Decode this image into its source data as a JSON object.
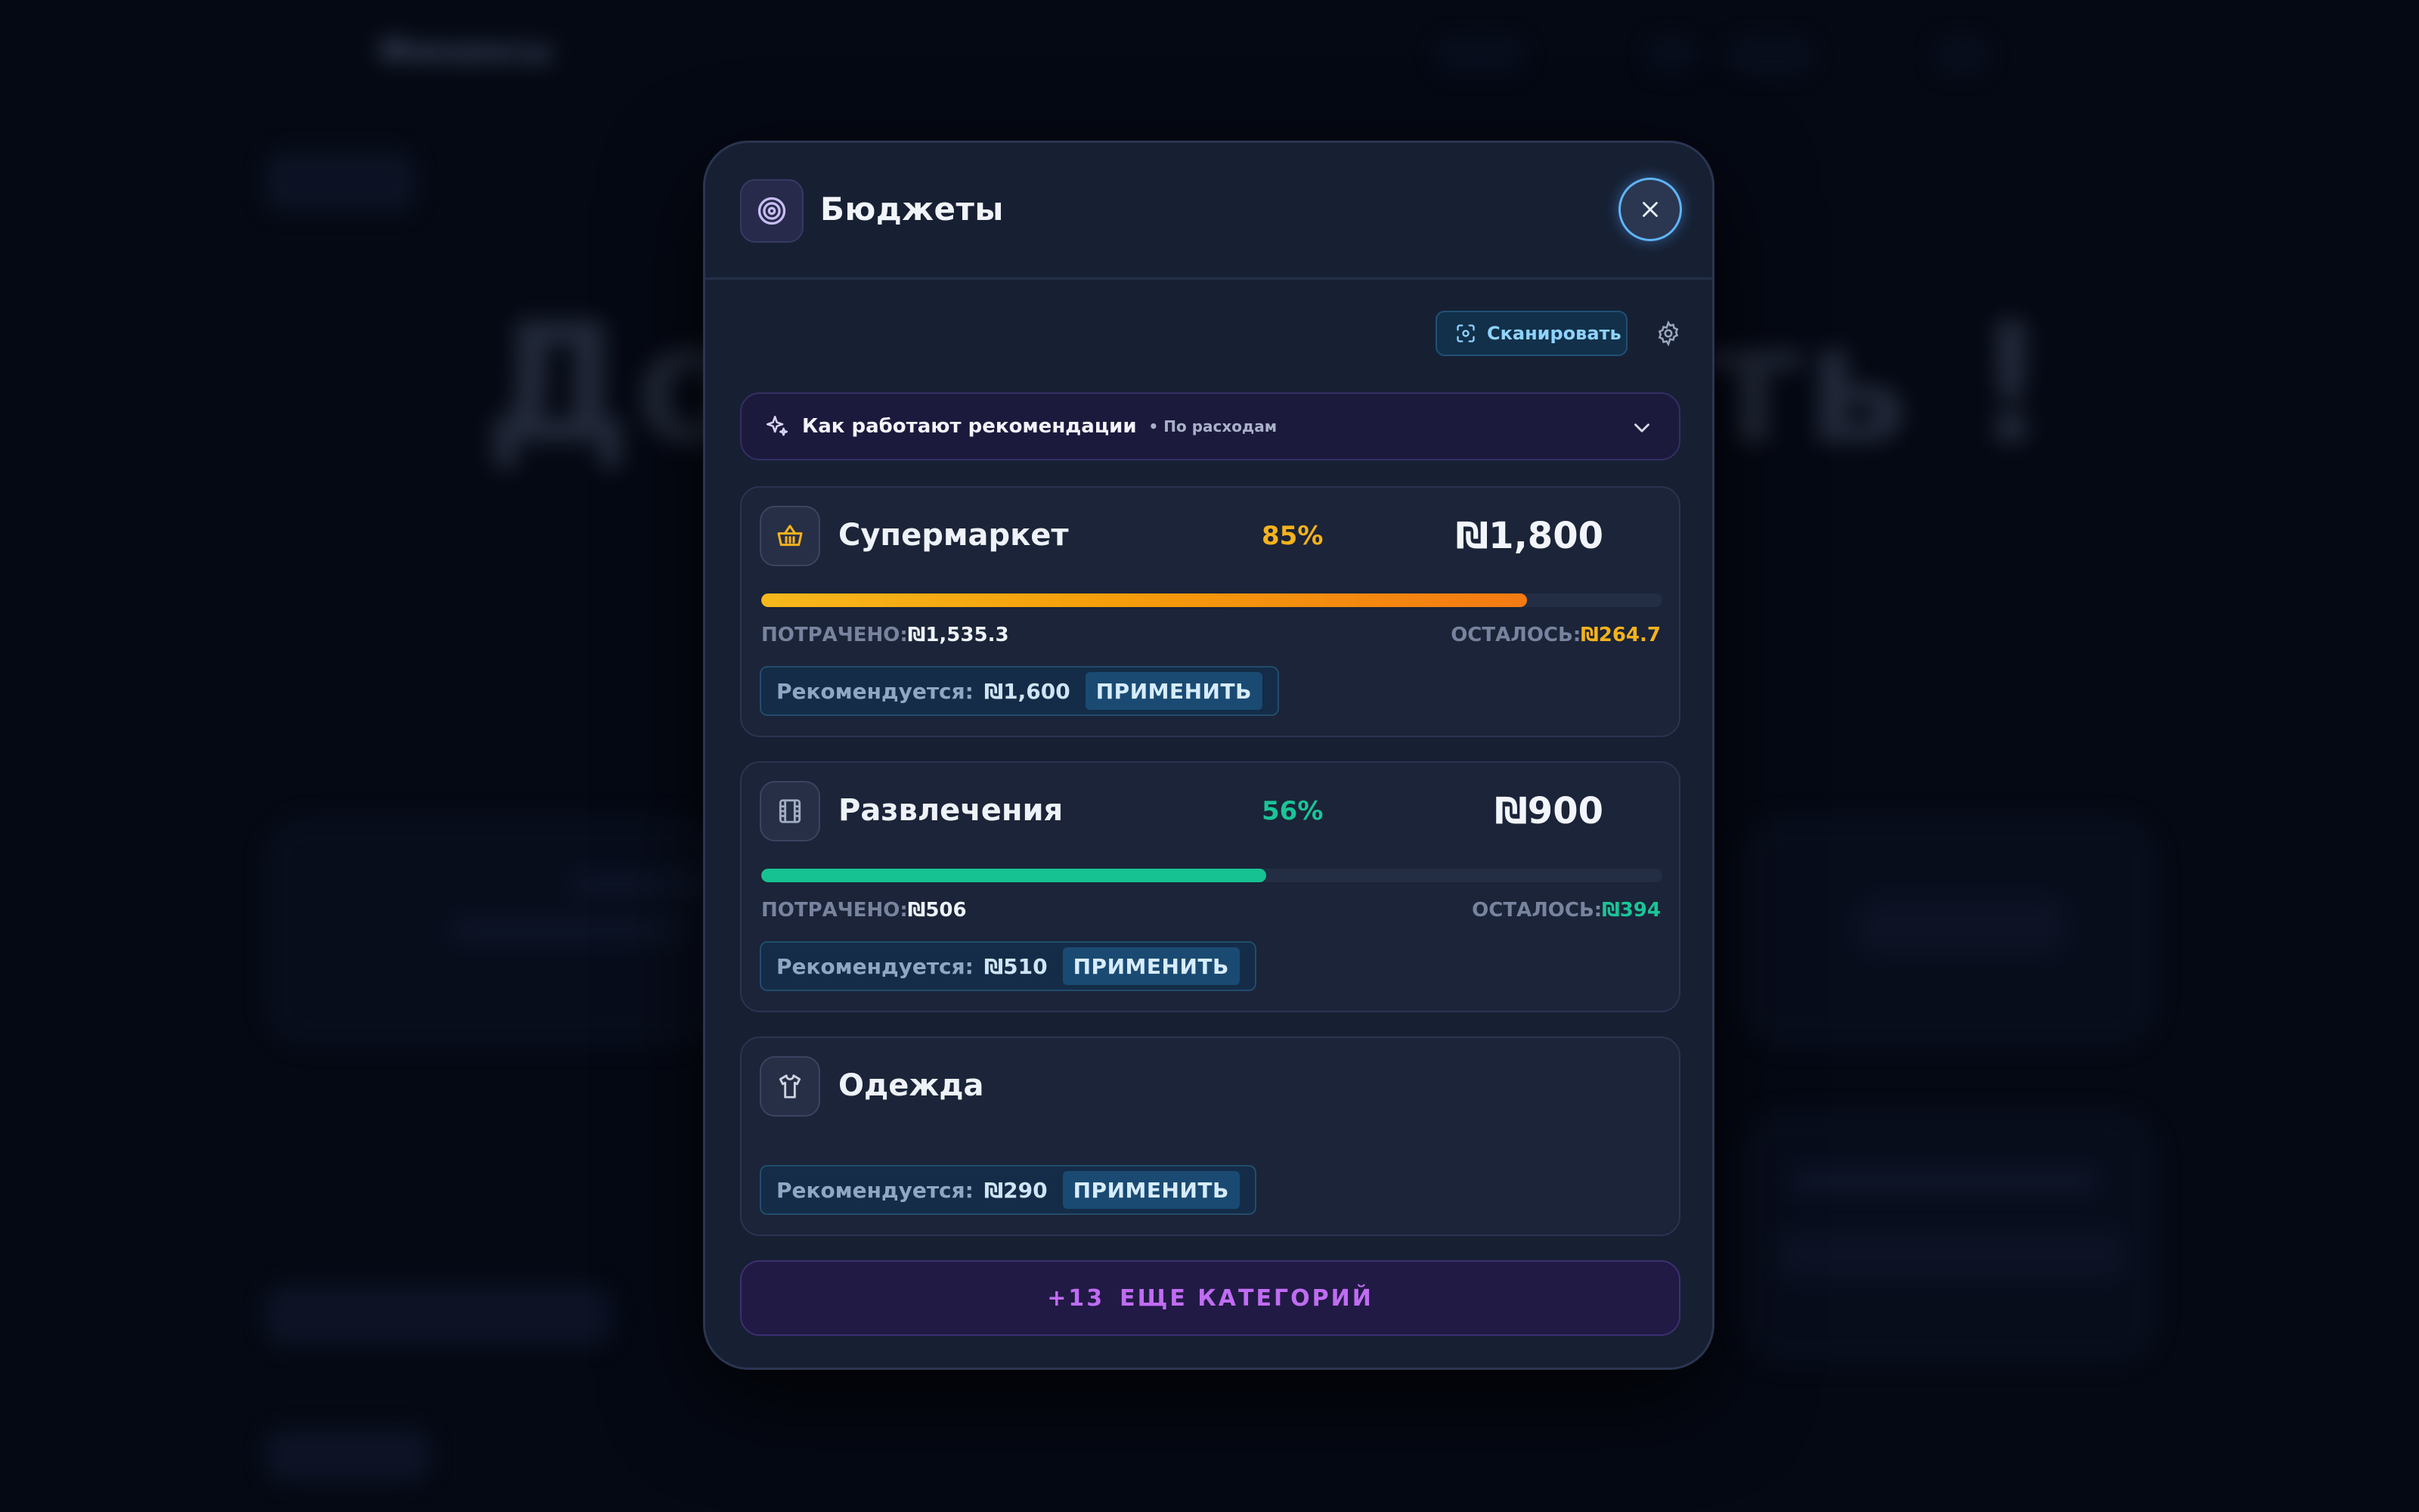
{
  "background": {
    "nav_logo": "Финансы",
    "hero_fragments": [
      "До",
      "ть !"
    ]
  },
  "modal": {
    "title": "Бюджеты",
    "header_icon": "target-icon",
    "close_icon": "close-icon",
    "scan_button": {
      "label": "Сканировать",
      "icon": "scan-icon"
    },
    "settings_icon": "gear-icon",
    "info": {
      "icon": "sparkles-icon",
      "title": "Как работают рекомендации",
      "subtitle": "• По расходам",
      "chevron": "chevron-down-icon"
    },
    "spent_label": "ПОТРАЧЕНО:",
    "remaining_label": "ОСТАЛОСЬ:",
    "recommended_label": "Рекомендуется:",
    "apply_label": "ПРИМЕНИТЬ",
    "categories": [
      {
        "name": "Супермаркет",
        "icon": "basket-icon",
        "percent": "85%",
        "amount": "₪1,800",
        "progress": 0.85,
        "spent": "₪1,535.3",
        "remaining": "₪264.7",
        "recommended": "₪1,600",
        "color": "#f5b21d"
      },
      {
        "name": "Развлечения",
        "icon": "film-icon",
        "percent": "56%",
        "amount": "₪900",
        "progress": 0.56,
        "spent": "₪506",
        "remaining": "₪394",
        "recommended": "₪510",
        "color": "#1bc497"
      },
      {
        "name": "Одежда",
        "icon": "shirt-icon",
        "recommended": "₪290"
      }
    ],
    "more": {
      "count": "+13",
      "label": "ЕЩЕ КАТЕГОРИЙ"
    }
  }
}
